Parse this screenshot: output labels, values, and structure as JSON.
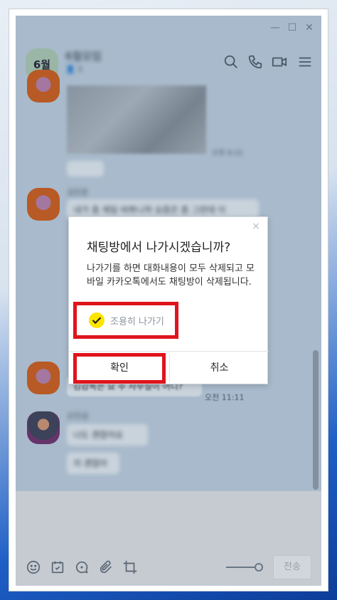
{
  "window": {
    "controls": {
      "minimize": "—",
      "maximize": "☐",
      "close": "✕"
    }
  },
  "header": {
    "avatar_text": "6월",
    "title": "6월모임",
    "subtitle": "👤 5"
  },
  "messages": {
    "image_time": "오후 8:31",
    "sender1": "김민준",
    "msg1": "내가 좀 제일 바쁘니까 요즘은 좀 그런데 이",
    "msg2": "김감독은 요 주 사무실이 어디?",
    "msg2_time": "오전 11:11",
    "sender2": "오민성",
    "msg3": "나도 괜찮아요",
    "msg4": "저 괜찮아"
  },
  "dialog": {
    "close": "×",
    "title": "채팅방에서 나가시겠습니까?",
    "body": "나가기를 하면 대화내용이 모두 삭제되고 모바일 카카오톡에서도 채팅방이 삭제됩니다.",
    "quiet_leave": "조용히 나가기",
    "confirm": "확인",
    "cancel": "취소"
  },
  "input": {
    "send": "전송"
  },
  "colors": {
    "highlight": "#e0141c",
    "kakao_yellow": "#fee500"
  }
}
